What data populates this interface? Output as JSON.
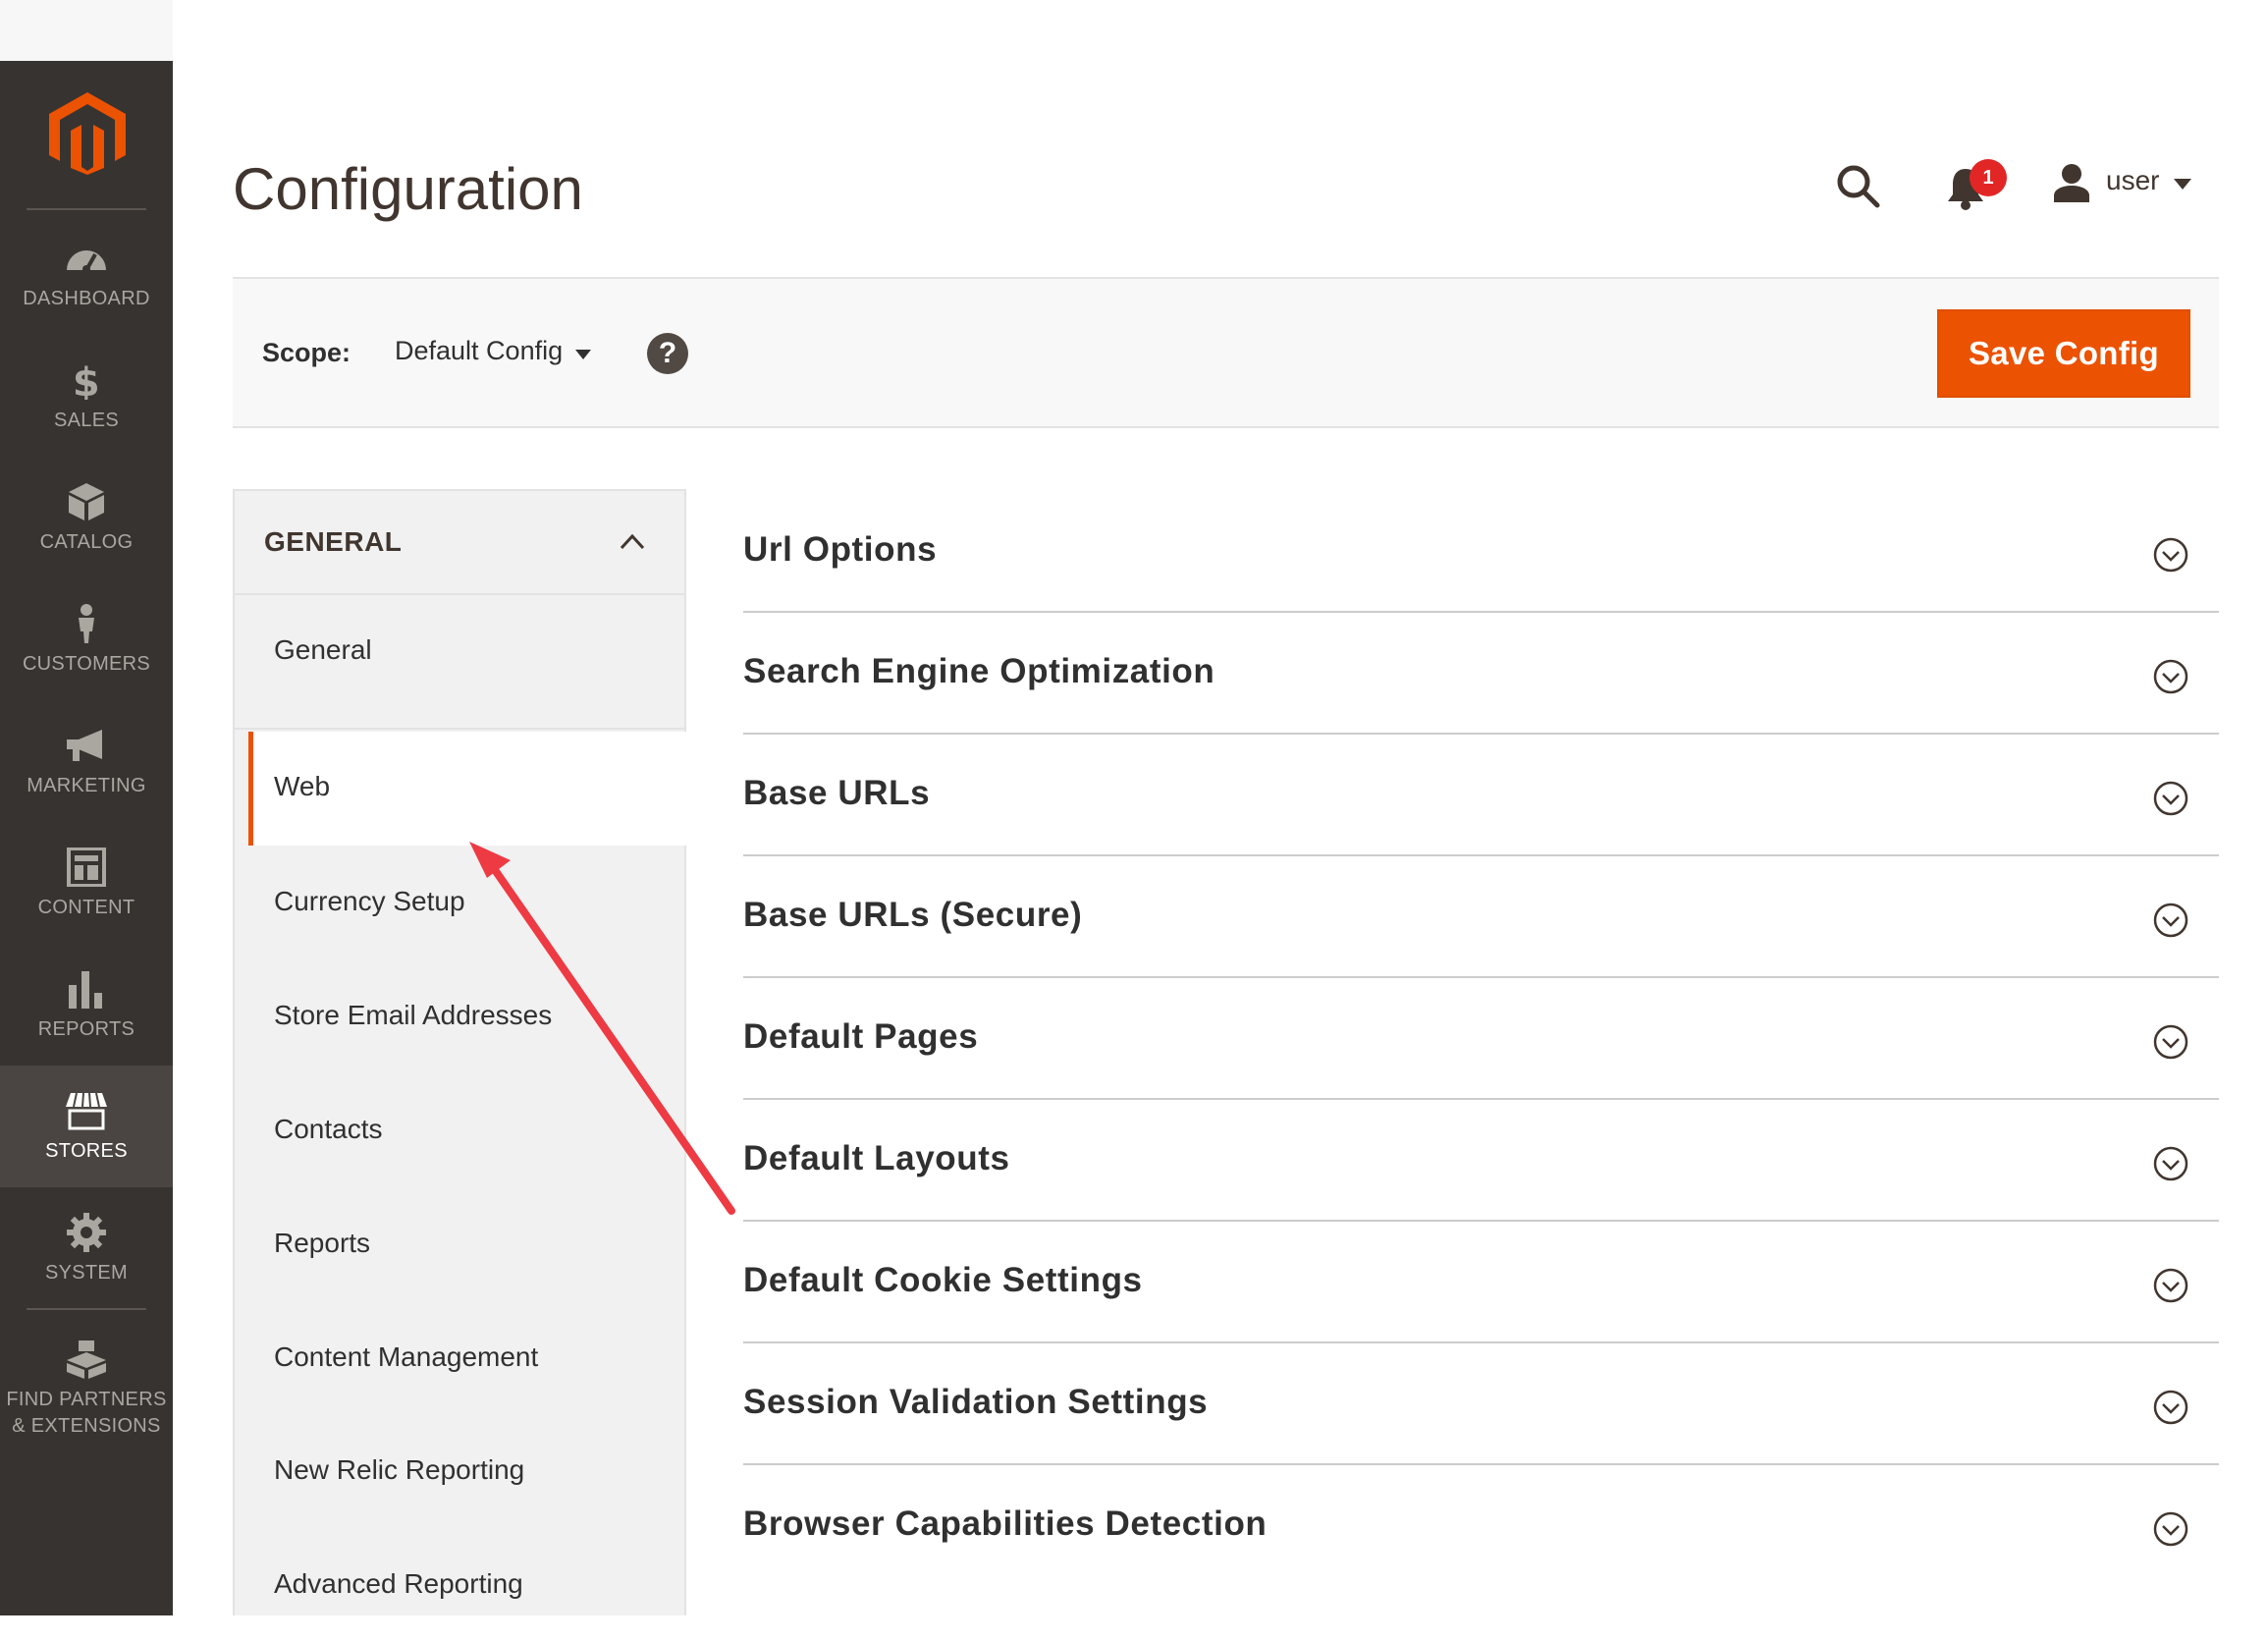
{
  "sidebar": {
    "items": [
      {
        "label": "DASHBOARD",
        "icon": "dashboard-icon"
      },
      {
        "label": "SALES",
        "icon": "dollar-icon"
      },
      {
        "label": "CATALOG",
        "icon": "box-icon"
      },
      {
        "label": "CUSTOMERS",
        "icon": "person-icon"
      },
      {
        "label": "MARKETING",
        "icon": "megaphone-icon"
      },
      {
        "label": "CONTENT",
        "icon": "layout-icon"
      },
      {
        "label": "REPORTS",
        "icon": "bar-chart-icon"
      },
      {
        "label": "STORES",
        "icon": "storefront-icon",
        "active": true
      },
      {
        "label": "SYSTEM",
        "icon": "gear-icon"
      },
      {
        "label_line1": "FIND PARTNERS",
        "label_line2": "& EXTENSIONS",
        "icon": "boxes-icon"
      }
    ],
    "colors": {
      "background": "#373330",
      "active": "#4a4542",
      "logo": "#eb5202"
    }
  },
  "header": {
    "title": "Configuration",
    "notification_count": "1",
    "user_name": "user"
  },
  "scope_bar": {
    "label": "Scope:",
    "selected": "Default Config",
    "help": "?",
    "save_label": "Save Config",
    "accent": "#eb5202"
  },
  "tabs": {
    "group_title": "GENERAL",
    "items": [
      {
        "label": "General"
      },
      {
        "label": "Web",
        "active": true
      },
      {
        "label": "Currency Setup"
      },
      {
        "label": "Store Email Addresses"
      },
      {
        "label": "Contacts"
      },
      {
        "label": "Reports"
      },
      {
        "label": "Content Management"
      },
      {
        "label": "New Relic Reporting"
      },
      {
        "label": "Advanced Reporting"
      }
    ]
  },
  "sections": [
    {
      "title": "Url Options"
    },
    {
      "title": "Search Engine Optimization"
    },
    {
      "title": "Base URLs"
    },
    {
      "title": "Base URLs (Secure)"
    },
    {
      "title": "Default Pages"
    },
    {
      "title": "Default Layouts"
    },
    {
      "title": "Default Cookie Settings"
    },
    {
      "title": "Session Validation Settings"
    },
    {
      "title": "Browser Capabilities Detection"
    }
  ],
  "annotation": {
    "color": "#ee3a43"
  }
}
